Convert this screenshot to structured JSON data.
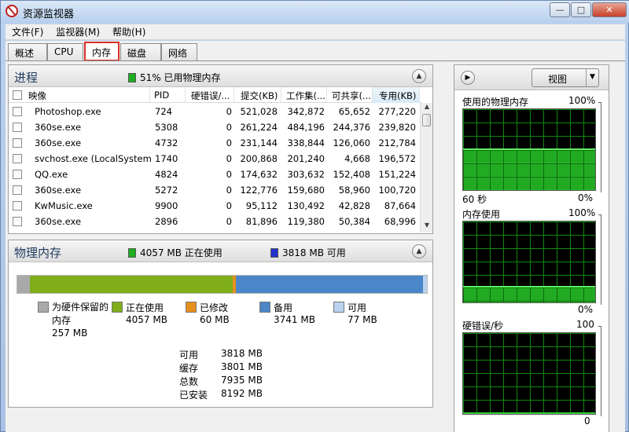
{
  "window": {
    "title": "资源监视器",
    "caption": {
      "minimize": "—",
      "maximize": "□",
      "close": "✕"
    }
  },
  "menu": [
    "文件(F)",
    "监视器(M)",
    "帮助(H)"
  ],
  "tabs": [
    {
      "label": "概述",
      "active": false
    },
    {
      "label": "CPU",
      "active": false
    },
    {
      "label": "内存",
      "active": true
    },
    {
      "label": "磁盘",
      "active": false
    },
    {
      "label": "网络",
      "active": false
    }
  ],
  "processes": {
    "title": "进程",
    "status": "51% 已用物理内存",
    "status_color": "#1fae1f",
    "columns": [
      "映像",
      "PID",
      "硬错误/...",
      "提交(KB)",
      "工作集(...",
      "可共享(...",
      "专用(KB)"
    ],
    "sorted_column": "专用(KB)",
    "rows": [
      [
        "Photoshop.exe",
        "724",
        "0",
        "521,028",
        "342,872",
        "65,652",
        "277,220"
      ],
      [
        "360se.exe",
        "5308",
        "0",
        "261,224",
        "484,196",
        "244,376",
        "239,820"
      ],
      [
        "360se.exe",
        "4732",
        "0",
        "231,144",
        "338,844",
        "126,060",
        "212,784"
      ],
      [
        "svchost.exe (LocalSystemN...",
        "1740",
        "0",
        "200,868",
        "201,240",
        "4,668",
        "196,572"
      ],
      [
        "QQ.exe",
        "4824",
        "0",
        "174,632",
        "303,632",
        "152,408",
        "151,224"
      ],
      [
        "360se.exe",
        "5272",
        "0",
        "122,776",
        "159,680",
        "58,960",
        "100,720"
      ],
      [
        "KwMusic.exe",
        "9900",
        "0",
        "95,112",
        "130,492",
        "42,828",
        "87,664"
      ],
      [
        "360se.exe",
        "2896",
        "0",
        "81,896",
        "119,380",
        "50,384",
        "68,996"
      ]
    ]
  },
  "physical": {
    "title": "物理内存",
    "in_use": "4057 MB 正在使用",
    "available": "3818 MB 可用",
    "in_use_color": "#1fae1f",
    "available_color": "#2233cc",
    "bar_mb": {
      "reserved": 257,
      "in_use": 4057,
      "modified": 60,
      "standby": 3741,
      "free": 77
    },
    "legend": [
      {
        "label": "为硬件保留的内存",
        "value": "257 MB",
        "color": "#a9a9a9"
      },
      {
        "label": "正在使用",
        "value": "4057 MB",
        "color": "#7fae1a"
      },
      {
        "label": "已修改",
        "value": "60 MB",
        "color": "#e8901c"
      },
      {
        "label": "备用",
        "value": "3741 MB",
        "color": "#4a86c8"
      },
      {
        "label": "可用",
        "value": "77 MB",
        "color": "#b9d2ee"
      }
    ],
    "summary": [
      [
        "可用",
        "3818 MB"
      ],
      [
        "缓存",
        "3801 MB"
      ],
      [
        "总数",
        "7935 MB"
      ],
      [
        "已安装",
        "8192 MB"
      ]
    ]
  },
  "graphs": {
    "view_label": "视图",
    "items": [
      {
        "title": "使用的物理内存",
        "max": "100%",
        "min": "0%",
        "time": "60 秒",
        "level_percent": 51
      },
      {
        "title": "内存使用",
        "max": "100%",
        "min": "0%",
        "time": "",
        "level_percent": 20
      },
      {
        "title": "硬错误/秒",
        "max": "100",
        "min": "0",
        "time": "",
        "level_percent": 0
      }
    ]
  }
}
